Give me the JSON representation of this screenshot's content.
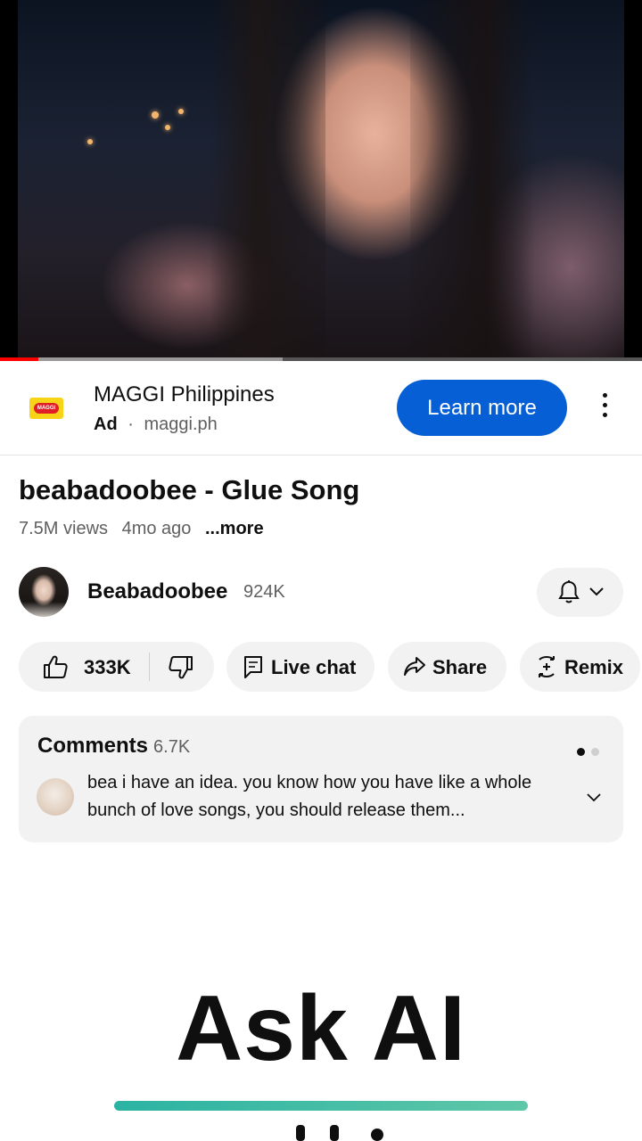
{
  "video": {
    "progress_played_fraction": 0.06,
    "progress_buffered_fraction": 0.44
  },
  "ad": {
    "advertiser": "MAGGI Philippines",
    "label": "Ad",
    "separator": "·",
    "domain": "maggi.ph",
    "logo_text": "MAGGI",
    "cta_label": "Learn more",
    "menu_icon": "more-vert-icon",
    "cta_color": "#065fd4"
  },
  "video_info": {
    "title": "beabadoobee - Glue Song",
    "views": "7.5M views",
    "age": "4mo ago",
    "more": "...more"
  },
  "channel": {
    "name": "Beabadoobee",
    "subscribers": "924K",
    "bell_icon": "bell-icon"
  },
  "actions": {
    "likes": "333K",
    "live_chat": "Live chat",
    "share": "Share",
    "remix": "Remix"
  },
  "comments": {
    "header": "Comments",
    "count": "6.7K",
    "top_comment": "bea i have an idea. you know how you have like a whole bunch of love songs, you should release them..."
  },
  "overlay": {
    "heading": "Ask AI",
    "accent": "#2bb3a3"
  }
}
